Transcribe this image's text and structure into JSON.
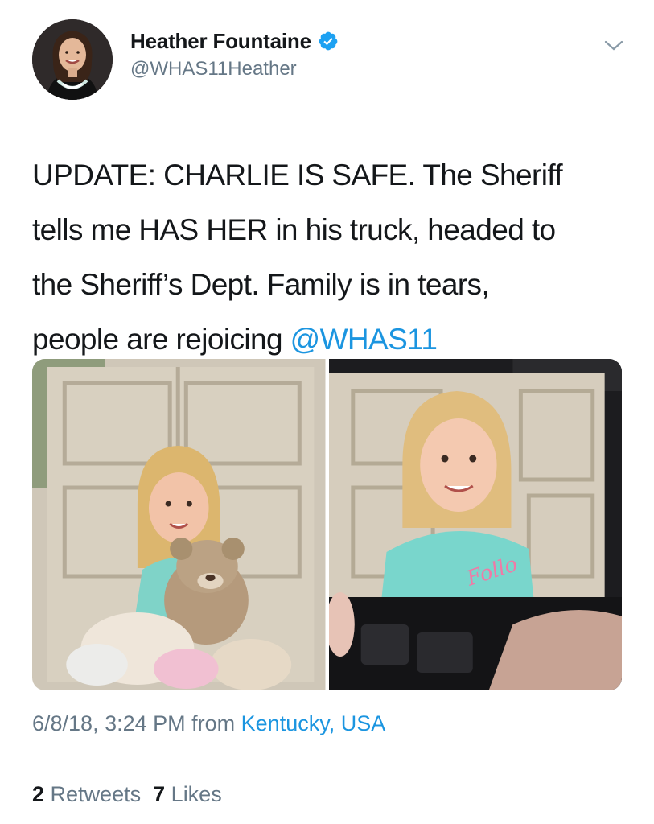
{
  "user": {
    "display_name": "Heather Fountaine",
    "handle": "@WHAS11Heather",
    "verified": true,
    "avatar_icon": "profile-photo"
  },
  "tweet": {
    "lines": [
      "UPDATE: CHARLIE IS SAFE. The Sheriff",
      "tells me HAS HER in his truck, headed to",
      "the Sheriff’s Dept. Family is in tears,",
      "people are rejoicing "
    ],
    "mention": "@WHAS11"
  },
  "media": {
    "photo_count": 2
  },
  "meta": {
    "timestamp": "6/8/18, 3:24 PM",
    "from_label": "from",
    "location": "Kentucky, USA"
  },
  "stats": {
    "retweets_count": "2",
    "retweets_label": "Retweets",
    "likes_count": "7",
    "likes_label": "Likes"
  },
  "colors": {
    "link_blue": "#1b95e0",
    "verified_blue": "#1da1f2",
    "secondary_text": "#657786",
    "primary_text": "#14171a"
  }
}
